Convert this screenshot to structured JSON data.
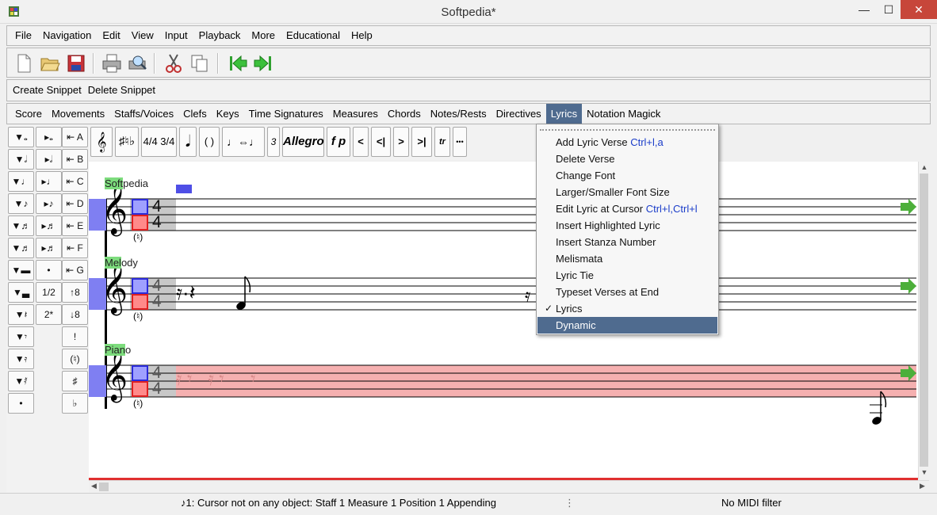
{
  "window": {
    "title": "Softpedia*",
    "minimize": "—",
    "maximize": "☐",
    "close": "✕"
  },
  "menubar": [
    "File",
    "Navigation",
    "Edit",
    "View",
    "Input",
    "Playback",
    "More",
    "Educational",
    "Help"
  ],
  "snippets": [
    "Create Snippet",
    "Delete Snippet"
  ],
  "modes": [
    "Score",
    "Movements",
    "Staffs/Voices",
    "Clefs",
    "Keys",
    "Time Signatures",
    "Measures",
    "Chords",
    "Notes/Rests",
    "Directives",
    "Lyrics",
    "Notation Magick"
  ],
  "active_mode": "Lyrics",
  "toolbar_icons": [
    "new-file-icon",
    "open-folder-icon",
    "save-icon",
    "print-icon",
    "print-preview-icon",
    "cut-icon",
    "copy-icon",
    "previous-movement-icon",
    "next-movement-icon"
  ],
  "palette": {
    "row_labels": [
      "A",
      "B",
      "C",
      "D",
      "E",
      "F",
      "G"
    ],
    "col3_extra": [
      "↑8",
      "↓8"
    ],
    "col2_extra": [
      "•",
      "1/2",
      "2*"
    ],
    "col2_accidentals": [
      "!",
      "(♮)",
      "♯",
      "♭"
    ],
    "dot": "•"
  },
  "text_toolbar": {
    "time_sig": "4/4 3/4",
    "paren": "( )",
    "tuplet": "3",
    "tempo": "Allegro",
    "dynamic": "f p",
    "nav": [
      "<",
      "<|",
      ">",
      ">|"
    ],
    "trill": "tr",
    "more": "•••"
  },
  "score": {
    "staffs": [
      {
        "name": "Softpedia",
        "highlight": "Soft",
        "rest": "pedia"
      },
      {
        "name": "Melody",
        "highlight": "Mel",
        "rest": "ody"
      },
      {
        "name": "Piano",
        "highlight": "Pian",
        "rest": "o"
      }
    ],
    "time_sig_num": "4",
    "time_sig_den": "4",
    "natural_mark": "(♮)"
  },
  "lyrics_menu": {
    "items": [
      {
        "label": "Add Lyric Verse",
        "accel": "Ctrl+l,a"
      },
      {
        "label": "Delete Verse",
        "accel": ""
      },
      {
        "label": "Change Font",
        "accel": ""
      },
      {
        "label": "Larger/Smaller Font Size",
        "accel": ""
      },
      {
        "label": "Edit Lyric at Cursor",
        "accel": "Ctrl+l,Ctrl+l"
      },
      {
        "label": "Insert Highlighted Lyric",
        "accel": ""
      },
      {
        "label": "Insert Stanza Number",
        "accel": ""
      },
      {
        "label": "Melismata",
        "accel": ""
      },
      {
        "label": "Lyric Tie",
        "accel": ""
      },
      {
        "label": "Typeset Verses at End",
        "accel": ""
      },
      {
        "label": "Lyrics",
        "accel": "",
        "checked": true
      },
      {
        "label": "Dynamic",
        "accel": "",
        "selected": true
      }
    ],
    "check_mark": "✓"
  },
  "status": {
    "message": "1: Cursor not on any object:  Staff 1 Measure 1 Position 1 Appending",
    "separator": "⋮",
    "midi": "No MIDI filter"
  },
  "colors": {
    "accent": "#4f6b8f",
    "cursor_blue": "#2b2bd9",
    "cursor_red": "#e02020",
    "lyric_green": "#7ddc7d",
    "piano_staff_bg": "#f5b0b0"
  }
}
